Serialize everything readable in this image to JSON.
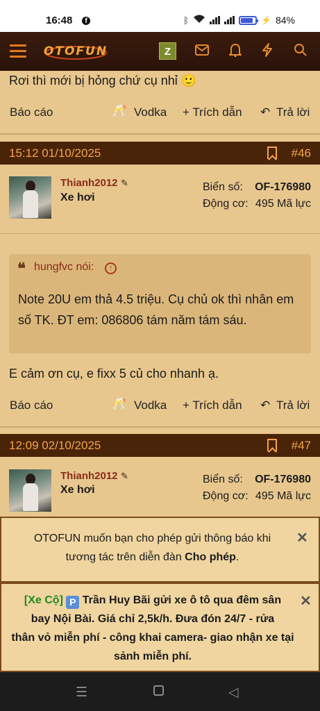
{
  "status_bar": {
    "time": "16:48",
    "battery": "84%"
  },
  "navbar": {
    "logo": "OTOFUN",
    "user_initial": "Z"
  },
  "prev_post": {
    "text": "Rơi thì mới bị hỏng chứ cụ nhỉ 🙂",
    "actions": {
      "report": "Báo cáo",
      "vodka": "Vodka",
      "quote": "+ Trích dẫn",
      "reply": "Trả lời"
    }
  },
  "post46": {
    "datetime": "15:12 01/10/2025",
    "number": "#46",
    "username": "Thianh2012",
    "rank": "Xe hơi",
    "plate_label": "Biển số:",
    "plate_value": "OF-176980",
    "engine_label": "Động cơ:",
    "engine_value": "495 Mã lực",
    "quote_author": "hungfvc nói:",
    "quote_body": "Note 20U em thả 4.5 triệu. Cụ chủ ok thì nhân em số TK. ĐT em: 086806 tám năm tám sáu.",
    "text": "E cảm ơn cụ, e fixx 5 củ cho nhanh ạ.",
    "actions": {
      "report": "Báo cáo",
      "vodka": "Vodka",
      "quote": "+ Trích dẫn",
      "reply": "Trả lời"
    }
  },
  "post47": {
    "datetime": "12:09 02/10/2025",
    "number": "#47",
    "username": "Thianh2012",
    "rank": "Xe hơi",
    "plate_label": "Biển số:",
    "plate_value": "OF-176980",
    "engine_label": "Động cơ:",
    "engine_value": "495 Mã lực"
  },
  "notification_prompt": {
    "line1": "OTOFUN muốn bạn cho phép gửi thông báo khi",
    "line2_prefix": "tương tác trên diễn đàn ",
    "allow": "Cho phép",
    "line2_suffix": "."
  },
  "ad_banner": {
    "tag": "[Xe Cộ]",
    "icon": "P",
    "text_line1": " Trần Huy Bãi gửi xe ô tô qua đêm sân",
    "text_line2": "bay Nội Bài. Giá chỉ 2,5k/h. Đưa đón 24/7 - rửa",
    "text_line3": "thân vỏ miễn phí - công khai camera- giao nhận xe tại",
    "text_line4": "sảnh miễn phí."
  },
  "colors": {
    "accent": "#e58a2a",
    "post_bar": "#4a2409",
    "background": "#e8c78e"
  }
}
